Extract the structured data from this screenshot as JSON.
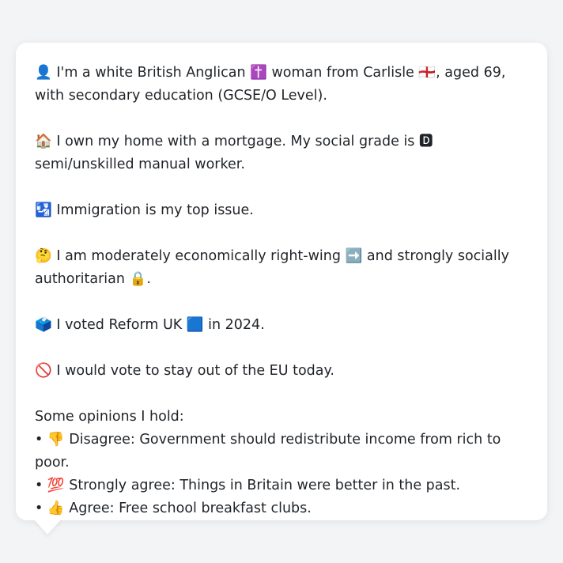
{
  "profile": {
    "identity": "👤 I'm a white British Anglican ✝️ woman from Carlisle 🏴󠁧󠁢󠁥󠁮󠁧󠁿, aged 69, with secondary education (GCSE/O Level).",
    "housing": "🏠 I own my home with a mortgage. My social grade is 🅳 semi/unskilled manual worker.",
    "top_issue": "🛂 Immigration is my top issue.",
    "ideology": "🤔 I am moderately economically right-wing ➡️ and strongly socially authoritarian 🔒.",
    "vote_2024": "🗳️ I voted Reform UK 🟦 in 2024.",
    "eu_vote": "🚫 I would vote to stay out of the EU today."
  },
  "opinions": {
    "title": "Some opinions I hold:",
    "items": [
      "• 👎 Disagree: Government should redistribute income from rich to poor.",
      "• 💯 Strongly agree: Things in Britain were better in the past.",
      "• 👍 Agree: Free school breakfast clubs."
    ]
  }
}
